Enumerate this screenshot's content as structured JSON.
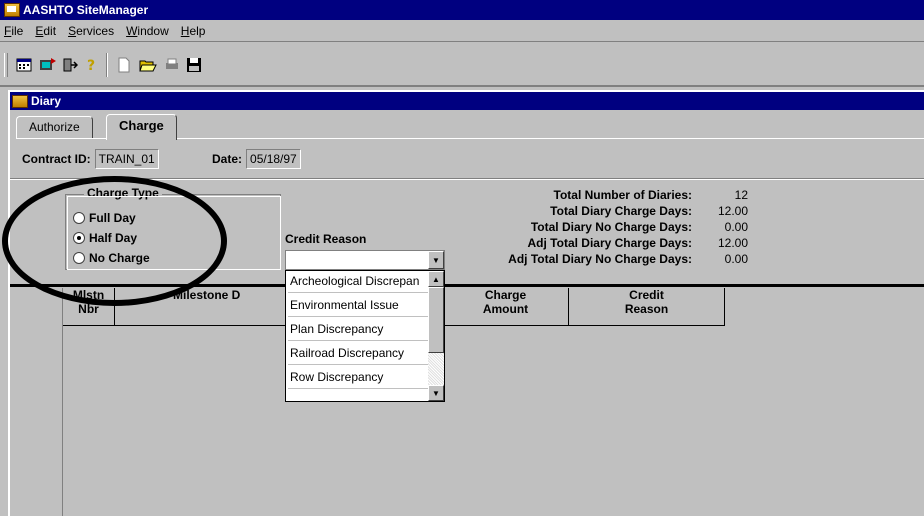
{
  "window": {
    "title": "AASHTO SiteManager"
  },
  "menu": [
    "File",
    "Edit",
    "Services",
    "Window",
    "Help"
  ],
  "child_window": {
    "title": "Diary"
  },
  "tabs": [
    {
      "label": "Authorize",
      "active": false
    },
    {
      "label": "Charge",
      "active": true
    }
  ],
  "header": {
    "contract_label": "Contract ID:",
    "contract_value": "TRAIN_01",
    "date_label": "Date:",
    "date_value": "05/18/97"
  },
  "charge_type": {
    "title": "Charge Type",
    "options": [
      {
        "label": "Full Day",
        "checked": false
      },
      {
        "label": "Half Day",
        "checked": true
      },
      {
        "label": "No Charge",
        "checked": false
      }
    ]
  },
  "credit_reason": {
    "label": "Credit Reason",
    "value": "",
    "options": [
      "Archeological Discrepan",
      "Environmental Issue",
      "Plan Discrepancy",
      "Railroad Discrepancy",
      "Row Discrepancy"
    ]
  },
  "totals": [
    {
      "label": "Total Number of Diaries:",
      "value": "12"
    },
    {
      "label": "Total Diary Charge Days:",
      "value": "12.00"
    },
    {
      "label": "Total Diary No Charge Days:",
      "value": "0.00"
    },
    {
      "label": "Adj Total Diary Charge Days:",
      "value": "12.00"
    },
    {
      "label": "Adj Total Diary No Charge Days:",
      "value": "0.00"
    }
  ],
  "grid": {
    "columns": [
      {
        "line1": "Mlstn",
        "line2": "Nbr"
      },
      {
        "line1": "",
        "line2": "Milestone D"
      },
      {
        "line1": "Charge",
        "line2": "Amount"
      },
      {
        "line1": "Credit",
        "line2": "Reason"
      }
    ]
  }
}
